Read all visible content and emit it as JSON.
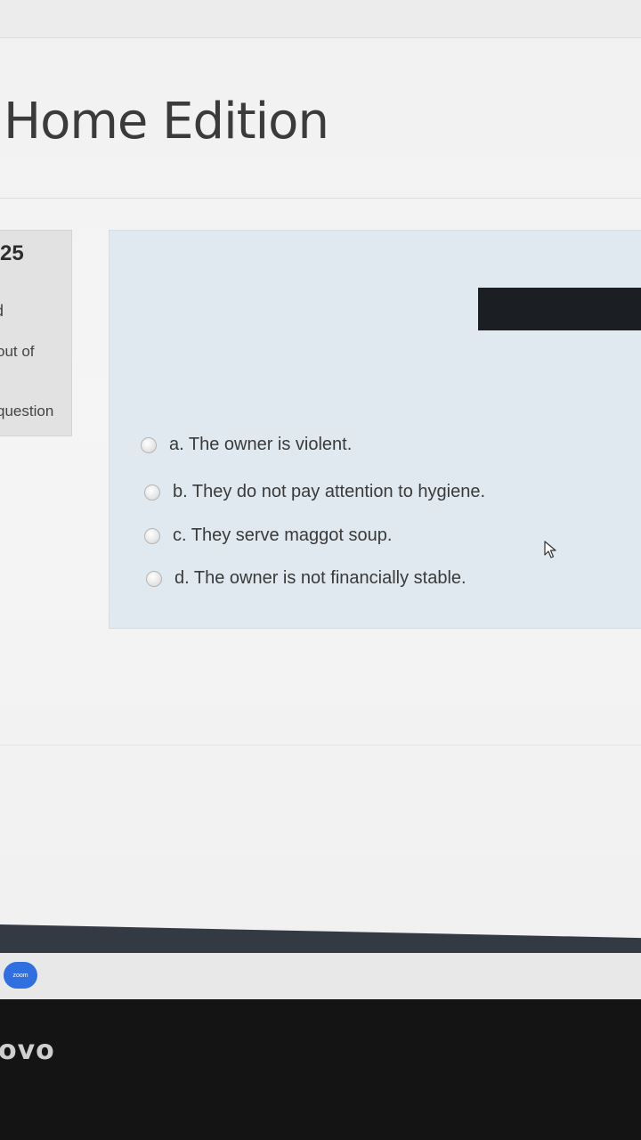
{
  "header": {
    "title": "Home Edition"
  },
  "question_info": {
    "number": "25",
    "state": "d",
    "mark": "out of",
    "flag": "question"
  },
  "answers": [
    {
      "label": "a. The owner is violent."
    },
    {
      "label": "b. They do not pay attention to hygiene."
    },
    {
      "label": "c. They serve maggot soup."
    },
    {
      "label": "d. The owner is not financially stable."
    }
  ],
  "taskbar": {
    "zoom_label": "zoom"
  },
  "bezel": {
    "brand": "ovo"
  },
  "colors": {
    "question_background": "#dfe9ef",
    "taskbar": "#343a44",
    "zoom_button": "#2f6fe0"
  }
}
